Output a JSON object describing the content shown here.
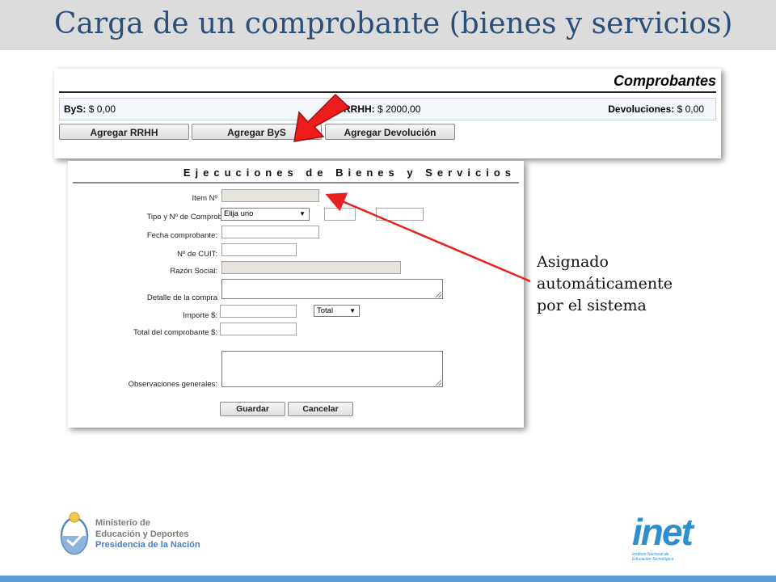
{
  "slide": {
    "title": "Carga de un comprobante (bienes y servicios)"
  },
  "comprobantes": {
    "title": "Comprobantes",
    "bys_label": "ByS:",
    "bys_value": "$ 0,00",
    "rrhh_label": "RRHH:",
    "rrhh_value": "$ 2000,00",
    "devoluciones_label": "Devoluciones:",
    "devoluciones_value": "$ 0,00",
    "buttons": {
      "agregar_rrhh": "Agregar RRHH",
      "agregar_bys": "Agregar ByS",
      "agregar_devolucion": "Agregar Devolución"
    }
  },
  "form": {
    "title": "Ejecuciones de Bienes y Servicios",
    "labels": {
      "item": "Item Nº",
      "tipo": "Tipo y Nº de Comprobante:",
      "fecha": "Fecha comprobante:",
      "cuit": "Nº de CUIT:",
      "razon_social": "Razón Social:",
      "detalle": "Detalle de la compra",
      "importe": "Importe $:",
      "total": "Total del comprobante $:",
      "observaciones": "Observaciones generales:"
    },
    "tipo_select": "Elija uno",
    "importe_select": "Total",
    "separator": "-",
    "buttons": {
      "guardar": "Guardar",
      "cancelar": "Cancelar"
    }
  },
  "annotation": {
    "line1": "Asignado",
    "line2": "automáticamente",
    "line3": "por el sistema"
  },
  "logos": {
    "ministerio_line1": "Ministerio de",
    "ministerio_line2": "Educación y Deportes",
    "ministerio_line3": "Presidencia de la Nación",
    "inet": "inet",
    "inet_sub1": "Instituto Nacional de",
    "inet_sub2": "Educación Tecnológica"
  },
  "colors": {
    "title": "#2b4f7a",
    "arrow": "#e8201f",
    "accent_bar": "#5b9bd5"
  }
}
